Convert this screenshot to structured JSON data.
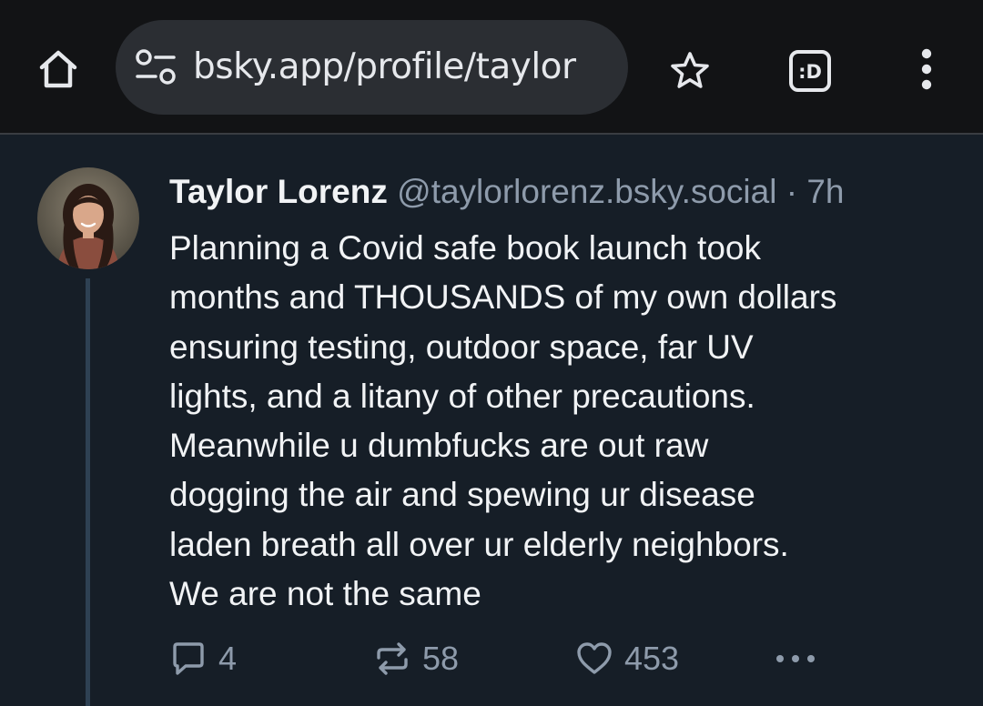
{
  "browser": {
    "url": "bsky.app/profile/taylor",
    "icons": {
      "home": "home-icon",
      "site_settings": "tune-icon",
      "bookmark": "star-icon",
      "tabs": "tab-switcher-icon",
      "menu": "more-vert-icon"
    },
    "tab_switcher_label": ":D"
  },
  "post": {
    "author_name": "Taylor Lorenz",
    "author_handle": "@taylorlorenz.bsky.social",
    "separator": "·",
    "timestamp": "7h",
    "text_lines": [
      "Planning a Covid safe book launch took",
      "months and THOUSANDS of my own dollars",
      "ensuring testing, outdoor space, far UV",
      "lights, and a litany of other precautions.",
      "Meanwhile u dumbfucks are out raw",
      "dogging the air and spewing ur disease",
      "laden breath all over ur elderly neighbors.",
      "We are not the same"
    ],
    "actions": {
      "replies": "4",
      "reposts": "58",
      "likes": "453"
    }
  },
  "colors": {
    "page_background": "#161e27",
    "browser_bar": "#121315",
    "url_pill": "#2b2e33",
    "text_primary": "#f1f3f5",
    "text_secondary": "#8e9bab",
    "thread_line": "#2e4153"
  }
}
